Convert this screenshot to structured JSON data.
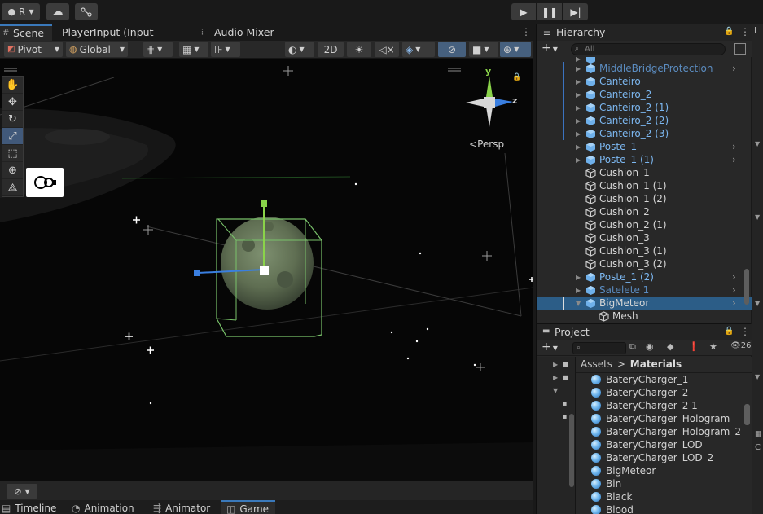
{
  "topbar": {
    "account_label": "R",
    "play_icon": "play-icon",
    "pause_icon": "pause-icon",
    "step_icon": "step-icon"
  },
  "scene_tabs": [
    {
      "label": "Scene",
      "icon": "hash-icon"
    },
    {
      "label": "PlayerInput (Input Actions)",
      "icon": ""
    },
    {
      "label": "Audio Mixer",
      "icon": "mixer-icon"
    }
  ],
  "scene_toolbar": {
    "pivot": "Pivot",
    "global": "Global",
    "mode_2d": "2D"
  },
  "scene_view": {
    "persp_label": "Persp",
    "gizmo": {
      "y": "y",
      "z": "z"
    }
  },
  "bottom_tabs": [
    {
      "label": "Timeline"
    },
    {
      "label": "Animation"
    },
    {
      "label": "Animator"
    },
    {
      "label": "Game"
    }
  ],
  "hierarchy": {
    "title": "Hierarchy",
    "search_placeholder": "All",
    "items": [
      {
        "label": "MiddleBridgeProtection",
        "style": "blue-dim",
        "icon": "prefab",
        "arrow": true,
        "chevron": true,
        "mark": true
      },
      {
        "label": "Canteiro",
        "style": "blue",
        "icon": "prefab",
        "arrow": true,
        "chevron": false,
        "mark": true
      },
      {
        "label": "Canteiro_2",
        "style": "blue",
        "icon": "prefab",
        "arrow": true,
        "chevron": false,
        "mark": true
      },
      {
        "label": "Canteiro_2 (1)",
        "style": "blue",
        "icon": "prefab",
        "arrow": true,
        "chevron": false,
        "mark": true
      },
      {
        "label": "Canteiro_2 (2)",
        "style": "blue",
        "icon": "prefab",
        "arrow": true,
        "chevron": false,
        "mark": true
      },
      {
        "label": "Canteiro_2 (3)",
        "style": "blue",
        "icon": "prefab",
        "arrow": true,
        "chevron": false,
        "mark": true
      },
      {
        "label": "Poste_1",
        "style": "blue",
        "icon": "prefab",
        "arrow": true,
        "chevron": true,
        "mark": false
      },
      {
        "label": "Poste_1 (1)",
        "style": "blue",
        "icon": "prefab",
        "arrow": true,
        "chevron": true,
        "mark": false
      },
      {
        "label": "Cushion_1",
        "style": "white",
        "icon": "cube",
        "arrow": false,
        "chevron": false,
        "mark": false
      },
      {
        "label": "Cushion_1 (1)",
        "style": "white",
        "icon": "cube",
        "arrow": false,
        "chevron": false,
        "mark": false
      },
      {
        "label": "Cushion_1 (2)",
        "style": "white",
        "icon": "cube",
        "arrow": false,
        "chevron": false,
        "mark": false
      },
      {
        "label": "Cushion_2",
        "style": "white",
        "icon": "cube",
        "arrow": false,
        "chevron": false,
        "mark": false
      },
      {
        "label": "Cushion_2 (1)",
        "style": "white",
        "icon": "cube",
        "arrow": false,
        "chevron": false,
        "mark": false
      },
      {
        "label": "Cushion_3",
        "style": "white",
        "icon": "cube",
        "arrow": false,
        "chevron": false,
        "mark": false
      },
      {
        "label": "Cushion_3 (1)",
        "style": "white",
        "icon": "cube",
        "arrow": false,
        "chevron": false,
        "mark": false
      },
      {
        "label": "Cushion_3 (2)",
        "style": "white",
        "icon": "cube",
        "arrow": false,
        "chevron": false,
        "mark": false
      },
      {
        "label": "Poste_1 (2)",
        "style": "blue",
        "icon": "prefab",
        "arrow": true,
        "chevron": true,
        "mark": false
      },
      {
        "label": "Satelete 1",
        "style": "blue-dim",
        "icon": "prefab",
        "arrow": true,
        "chevron": true,
        "mark": false
      },
      {
        "label": "BigMeteor",
        "style": "white",
        "icon": "prefab",
        "arrow": true,
        "chevron": true,
        "mark": true,
        "selected": true,
        "expanded": true
      },
      {
        "label": "Mesh",
        "style": "white",
        "icon": "cube",
        "arrow": false,
        "chevron": false,
        "mark": false,
        "indent": true
      }
    ]
  },
  "project": {
    "title": "Project",
    "count_label": "26",
    "breadcrumb": {
      "root": "Assets",
      "sep": ">",
      "current": "Materials"
    },
    "items": [
      "BateryCharger_1",
      "BateryCharger_2",
      "BateryCharger_2 1",
      "BateryCharger_Hologram",
      "BateryCharger_Hologram_2",
      "BateryCharger_LOD",
      "BateryCharger_LOD_2",
      "BigMeteor",
      "Bin",
      "Black",
      "Blood"
    ]
  }
}
